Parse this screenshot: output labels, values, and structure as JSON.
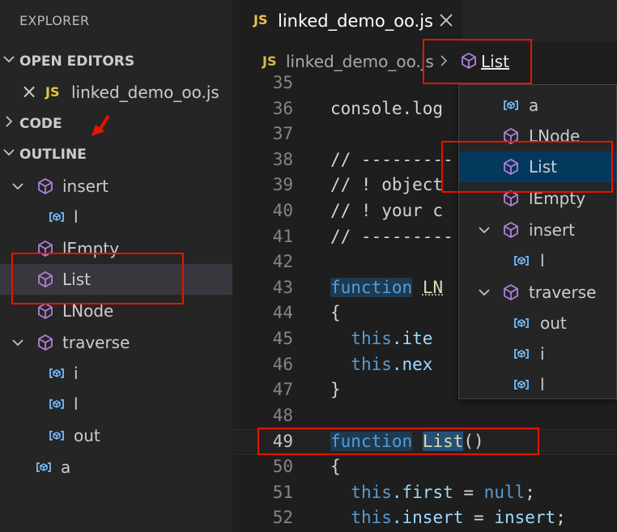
{
  "sidebar": {
    "title": "EXPLORER",
    "open_editors": {
      "label": "OPEN EDITORS",
      "item": {
        "close_glyph": "×",
        "lang": "JS",
        "name": "linked_demo_oo.js"
      }
    },
    "code_section": "CODE",
    "outline_section": "OUTLINE",
    "outline": [
      {
        "label": "insert",
        "kind": "method-icon"
      },
      {
        "label": "l",
        "kind": "variable-icon"
      },
      {
        "label": "lEmpty",
        "kind": "method-icon"
      },
      {
        "label": "List",
        "kind": "method-icon"
      },
      {
        "label": "LNode",
        "kind": "method-icon"
      },
      {
        "label": "traverse",
        "kind": "method-icon"
      },
      {
        "label": "i",
        "kind": "variable-icon"
      },
      {
        "label": "l",
        "kind": "variable-icon"
      },
      {
        "label": "out",
        "kind": "variable-icon"
      },
      {
        "label": "a",
        "kind": "variable-icon"
      }
    ]
  },
  "editor": {
    "tab": {
      "lang": "JS",
      "name": "linked_demo_oo.js"
    },
    "breadcrumb": {
      "lang": "JS",
      "file": "linked_demo_oo.js",
      "symbol": "List"
    },
    "lines": [
      {
        "n": "35",
        "t": ""
      },
      {
        "n": "36",
        "t": "console.log"
      },
      {
        "n": "37",
        "t": ""
      },
      {
        "n": "38",
        "t": "// ---------"
      },
      {
        "n": "39",
        "t": "// ! object"
      },
      {
        "n": "40",
        "t": "// ! your c"
      },
      {
        "n": "41",
        "t": "// ---------"
      },
      {
        "n": "42",
        "t": ""
      },
      {
        "n": "43",
        "kw": "function",
        "name": "LN"
      },
      {
        "n": "44",
        "t": "{"
      },
      {
        "n": "45",
        "a": "this",
        "b": ".ite"
      },
      {
        "n": "46",
        "a": "this",
        "b": ".nex"
      },
      {
        "n": "47",
        "t": "}"
      },
      {
        "n": "48",
        "t": ""
      },
      {
        "n": "49",
        "kw": "function",
        "name": "List",
        "rest": "()"
      },
      {
        "n": "50",
        "t": "{"
      },
      {
        "n": "51",
        "a": "this",
        "b": ".first",
        "c": " = ",
        "d": "null",
        "e": ";"
      },
      {
        "n": "52",
        "a": "this",
        "b": ".insert",
        "c": " = ",
        "d": "insert",
        "e": ";"
      }
    ]
  },
  "dropdown": [
    {
      "label": "a",
      "kind": "variable-icon"
    },
    {
      "label": "LNode",
      "kind": "method-icon"
    },
    {
      "label": "List",
      "kind": "method-icon"
    },
    {
      "label": "lEmpty",
      "kind": "method-icon"
    },
    {
      "label": "insert",
      "kind": "method-icon"
    },
    {
      "label": "l",
      "kind": "variable-icon"
    },
    {
      "label": "traverse",
      "kind": "method-icon"
    },
    {
      "label": "out",
      "kind": "variable-icon"
    },
    {
      "label": "i",
      "kind": "variable-icon"
    },
    {
      "label": "l",
      "kind": "variable-icon"
    }
  ],
  "colors": {
    "method_icon": "#b180d7",
    "variable_icon": "#75beff",
    "annotation": "#e51400"
  }
}
